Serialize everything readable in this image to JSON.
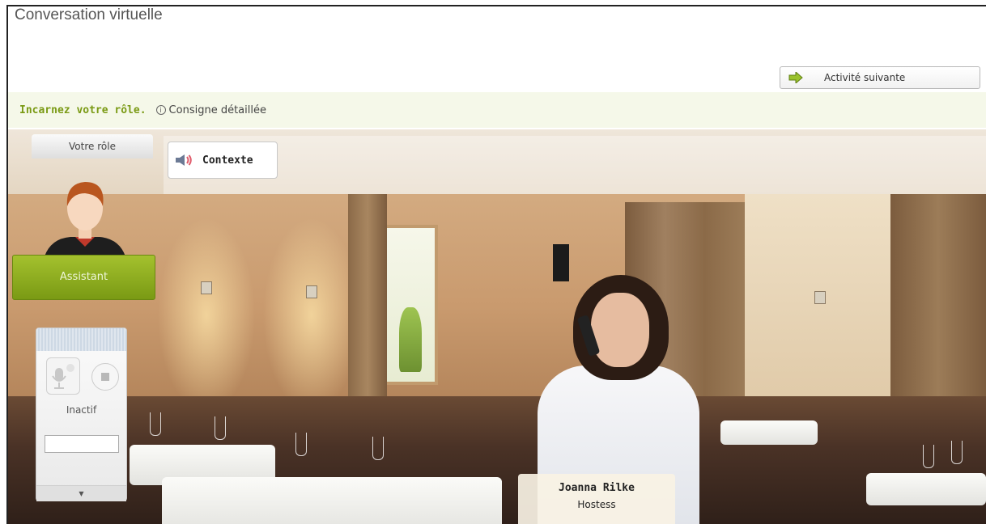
{
  "page": {
    "title": "Conversation virtuelle"
  },
  "header": {
    "next_activity_label": "Activité suivante",
    "next_activity_icon": "green-arrow-right-icon"
  },
  "instructions": {
    "bold_text": "Incarnez votre rôle.",
    "detail_link": "Consigne détaillée",
    "info_icon": "info-icon"
  },
  "context_button": {
    "label": "Contexte",
    "icon": "speaker-icon"
  },
  "role_panel": {
    "tab_label": "Votre rôle",
    "role_button": "Assistant"
  },
  "recorder": {
    "status": "Inactif",
    "input_value": ""
  },
  "character": {
    "name": "Joanna Rilke",
    "role": "Hostess"
  },
  "colors": {
    "accent_green": "#7a9a14",
    "instruction_bg": "#f5f8e9"
  }
}
